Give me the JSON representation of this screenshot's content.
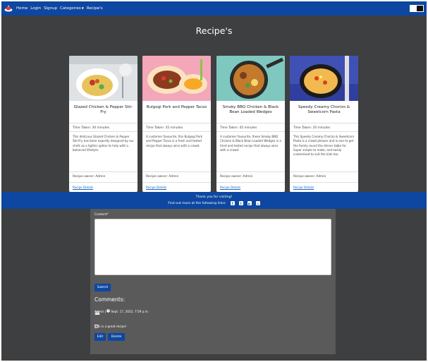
{
  "nav": {
    "links": [
      "Home",
      "Login",
      "Signup",
      "Categories",
      "Recipe's"
    ]
  },
  "page": {
    "title": "Recipe's"
  },
  "cards": [
    {
      "title": "Glazed Chicken & Pepper Stir-Fry",
      "time": "Time Taken: 30 minutes",
      "description": "This delicious Glazed Chicken & Pepper Stir-Fry has been expertly designed by our chefs as a lighter option to help with a balanced lifestyle.",
      "owner": "Recipe owner: Admin",
      "link": "Recipe Details"
    },
    {
      "title": "Bulgogi Pork and Pepper Tacos",
      "time": "Time Taken: 35 minutes",
      "description": "A customer favourite, this Bulgogi Pork and Pepper Tacos is a fresh and tested recipe that always wins with a crowd.",
      "owner": "Recipe owner: Admin",
      "link": "Recipe Details"
    },
    {
      "title": "Smoky BBQ Chicken & Black Bean Loaded Wedges",
      "time": "Time Taken: 45 minutes",
      "description": "A customer favourite, these Smoky BBQ Chicken & Black Bean Loaded Wedges is a tried and tested recipe that always wins with a crowd.",
      "owner": "Recipe owner: Admin",
      "link": "Recipe Details"
    },
    {
      "title": "Speedy Creamy Chorizo & Sweetcorn Pasta",
      "time": "Time Taken: 20 minutes",
      "description": "This Speedy Creamy Chorizo & Sweetcorn Pasta is a crowd pleaser and is one to get the family round the dinner table for. Super simple to make, and easily customised to suit the kids too.",
      "owner": "Recipe owner: Admin",
      "link": "Recipe Details"
    }
  ],
  "footer": {
    "thanks": "Thank you for visiting!",
    "find_more": "Find out more at the following links:",
    "icons": [
      "facebook-icon",
      "twitter-icon",
      "youtube-icon",
      "instagram-icon"
    ]
  },
  "comment_form": {
    "content_label": "Content*",
    "content_value": "",
    "submit_label": "Submit"
  },
  "comments": {
    "heading": "Comments:",
    "items": [
      {
        "author": "Admin",
        "date": "Sept. 17, 2022, 7:59 p.m.",
        "body": "This is a great recipe!",
        "edit_label": "Edit",
        "delete_label": "Delete"
      }
    ]
  },
  "colors": {
    "brand": "#0d47a1",
    "background": "#3e3f40",
    "panel": "#5a5a5a",
    "link": "#1565c0"
  }
}
